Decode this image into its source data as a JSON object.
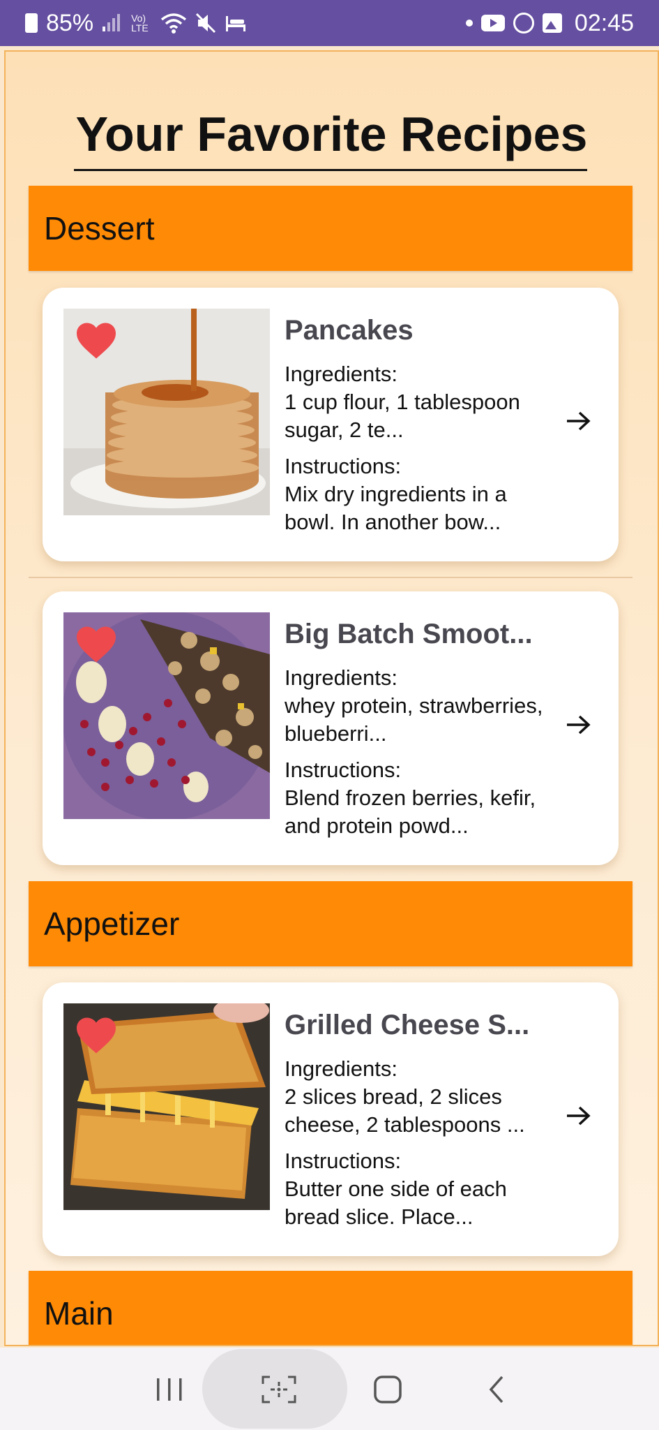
{
  "status_bar": {
    "battery": "85%",
    "signal": "Vo) LTE",
    "time": "02:45"
  },
  "page": {
    "title": "Your Favorite Recipes"
  },
  "categories": [
    {
      "name": "Dessert"
    },
    {
      "name": "Appetizer"
    },
    {
      "name": "Main"
    }
  ],
  "recipes": [
    {
      "name": "Pancakes",
      "ingredients_label": "Ingredients:",
      "ingredients": "1 cup flour, 1 tablespoon sugar, 2 te...",
      "instructions_label": "Instructions:",
      "instructions": " Mix dry ingredients in a bowl. In another bow...",
      "favorite": true,
      "image_icon": "pancakes-photo"
    },
    {
      "name": "Big Batch Smoot...",
      "ingredients_label": "Ingredients:",
      "ingredients": "whey protein, strawberries, blueberri...",
      "instructions_label": "Instructions:",
      "instructions": " Blend frozen berries, kefir, and protein powd...",
      "favorite": true,
      "image_icon": "smoothie-bowl-photo"
    },
    {
      "name": "Grilled Cheese S...",
      "ingredients_label": "Ingredients:",
      "ingredients": "2 slices bread, 2 slices cheese, 2 tablespoons ...",
      "instructions_label": "Instructions:",
      "instructions": " Butter one side of each bread slice. Place...",
      "favorite": true,
      "image_icon": "grilled-cheese-photo"
    }
  ],
  "colors": {
    "status_bar": "#654fa0",
    "category_header": "#ff8a05",
    "heart": "#ee4a4d",
    "recipe_name": "#48474f"
  }
}
